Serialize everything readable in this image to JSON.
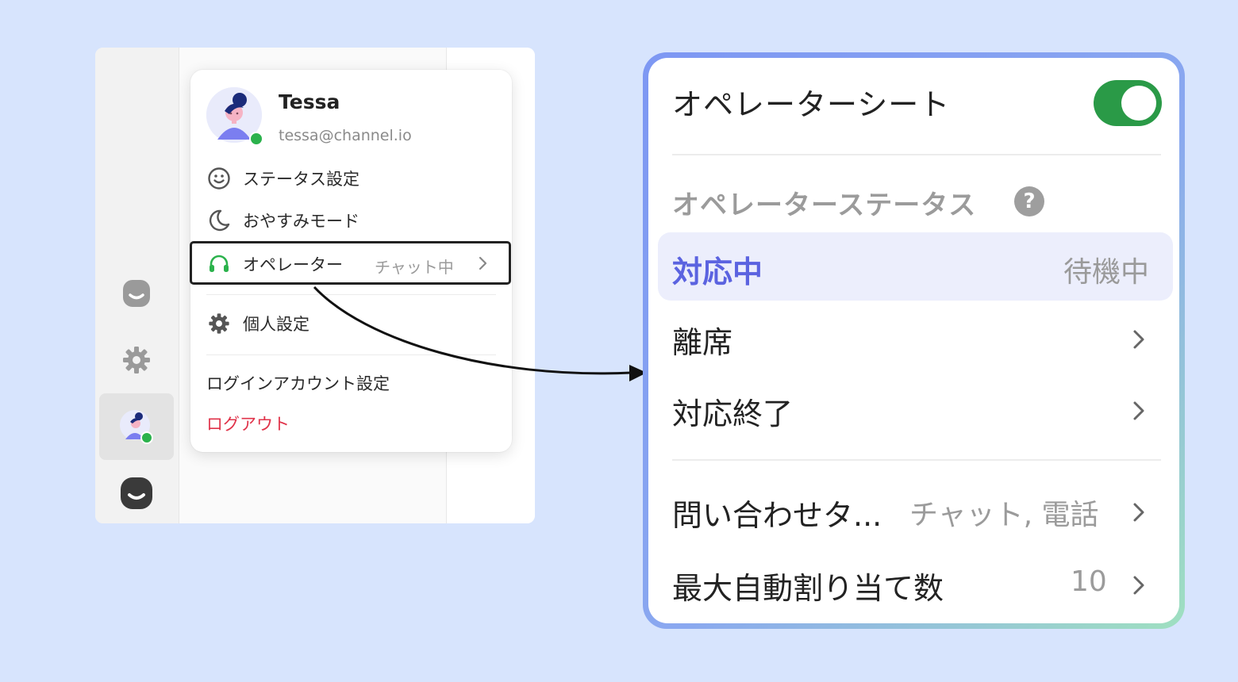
{
  "menu": {
    "user_name": "Tessa",
    "user_email": "tessa@channel.io",
    "items": {
      "status": "ステータス設定",
      "sleep": "おやすみモード",
      "operator": "オペレーター",
      "operator_status": "チャット中",
      "personal": "個人設定",
      "login_account": "ログインアカウント設定",
      "logout": "ログアウト"
    }
  },
  "sidebar": {
    "icons": [
      "chat-bubble-icon",
      "gear-icon",
      "user-avatar",
      "channel-logo-icon"
    ]
  },
  "zoom": {
    "title": "オペレーターシート",
    "toggle_on": true,
    "section_label": "オペレーターステータス",
    "help_glyph": "?",
    "active_status": "対応中",
    "active_status_sub": "待機中",
    "rows": {
      "away": "離席",
      "done": "対応終了",
      "inquiry_label": "問い合わせタ...",
      "inquiry_value": "チャット, 電話",
      "max_assign_label": "最大自動割り当て数",
      "max_assign_value": "10"
    }
  },
  "colors": {
    "background": "#d7e4fd",
    "toggle_green": "#2a9a47",
    "online_green": "#2bb24c",
    "active_text": "#5b63e0",
    "active_bg": "#eceefc",
    "logout_red": "#e0334a",
    "headset_green": "#2bb24c"
  }
}
